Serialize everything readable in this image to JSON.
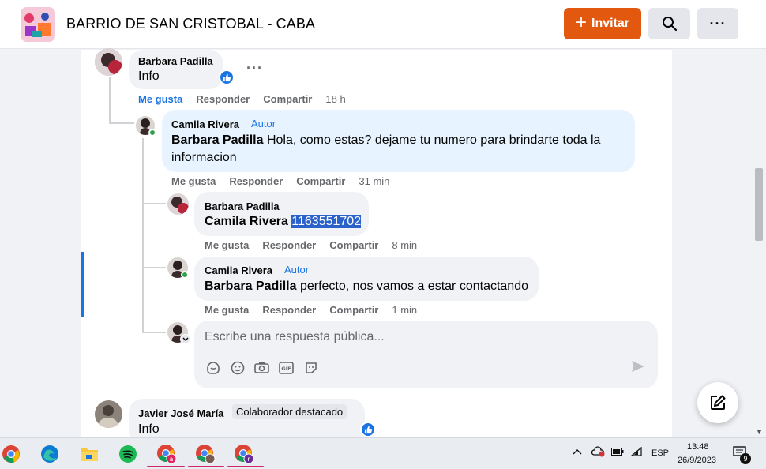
{
  "header": {
    "group_title": "BARRIO DE SAN CRISTOBAL - CABA",
    "invite_label": "Invitar",
    "invite_icon": "plus-icon",
    "search_icon": "search-icon",
    "more_label": "···"
  },
  "comments": [
    {
      "author": "Barbara Padilla",
      "text": "Info",
      "actions": {
        "like": "Me gusta",
        "reply": "Responder",
        "share": "Compartir",
        "time": "18 h"
      },
      "liked": true,
      "more": "···"
    },
    {
      "author": "Camila Rivera",
      "author_tag": "Autor",
      "mention": "Barbara Padilla",
      "text": " Hola, como estas? dejame tu numero para brindarte toda la informacion",
      "actions": {
        "like": "Me gusta",
        "reply": "Responder",
        "share": "Compartir",
        "time": "31 min"
      }
    },
    {
      "author": "Barbara Padilla",
      "mention": "Camila Rivera",
      "text": "1163551702",
      "actions": {
        "like": "Me gusta",
        "reply": "Responder",
        "share": "Compartir",
        "time": "8 min"
      }
    },
    {
      "author": "Camila Rivera",
      "author_tag": "Autor",
      "mention": "Barbara Padilla",
      "text": " perfecto, nos vamos a estar contactando",
      "actions": {
        "like": "Me gusta",
        "reply": "Responder",
        "share": "Compartir",
        "time": "1 min"
      }
    },
    {
      "author": "Javier José María",
      "badge": "Colaborador destacado",
      "text": "Info"
    }
  ],
  "reply_box": {
    "placeholder": "Escribe una respuesta pública...",
    "icons": [
      "sticker-icon",
      "emoji-icon",
      "camera-icon",
      "gif-icon",
      "avatar-sticker-icon"
    ],
    "send_icon": "send-icon"
  },
  "taskbar": {
    "apps": [
      "chrome-icon",
      "edge-icon",
      "file-explorer-icon",
      "spotify-icon",
      "chrome-profile-a-icon",
      "chrome-profile-photo-icon",
      "chrome-profile-r-icon"
    ],
    "language": "ESP",
    "time": "13:48",
    "date": "26/9/2023",
    "notifications": "9"
  },
  "colors": {
    "accent": "#1b74e4",
    "invite": "#e2580f",
    "author_bubble": "#e7f3ff",
    "bubble": "#f0f2f5"
  }
}
